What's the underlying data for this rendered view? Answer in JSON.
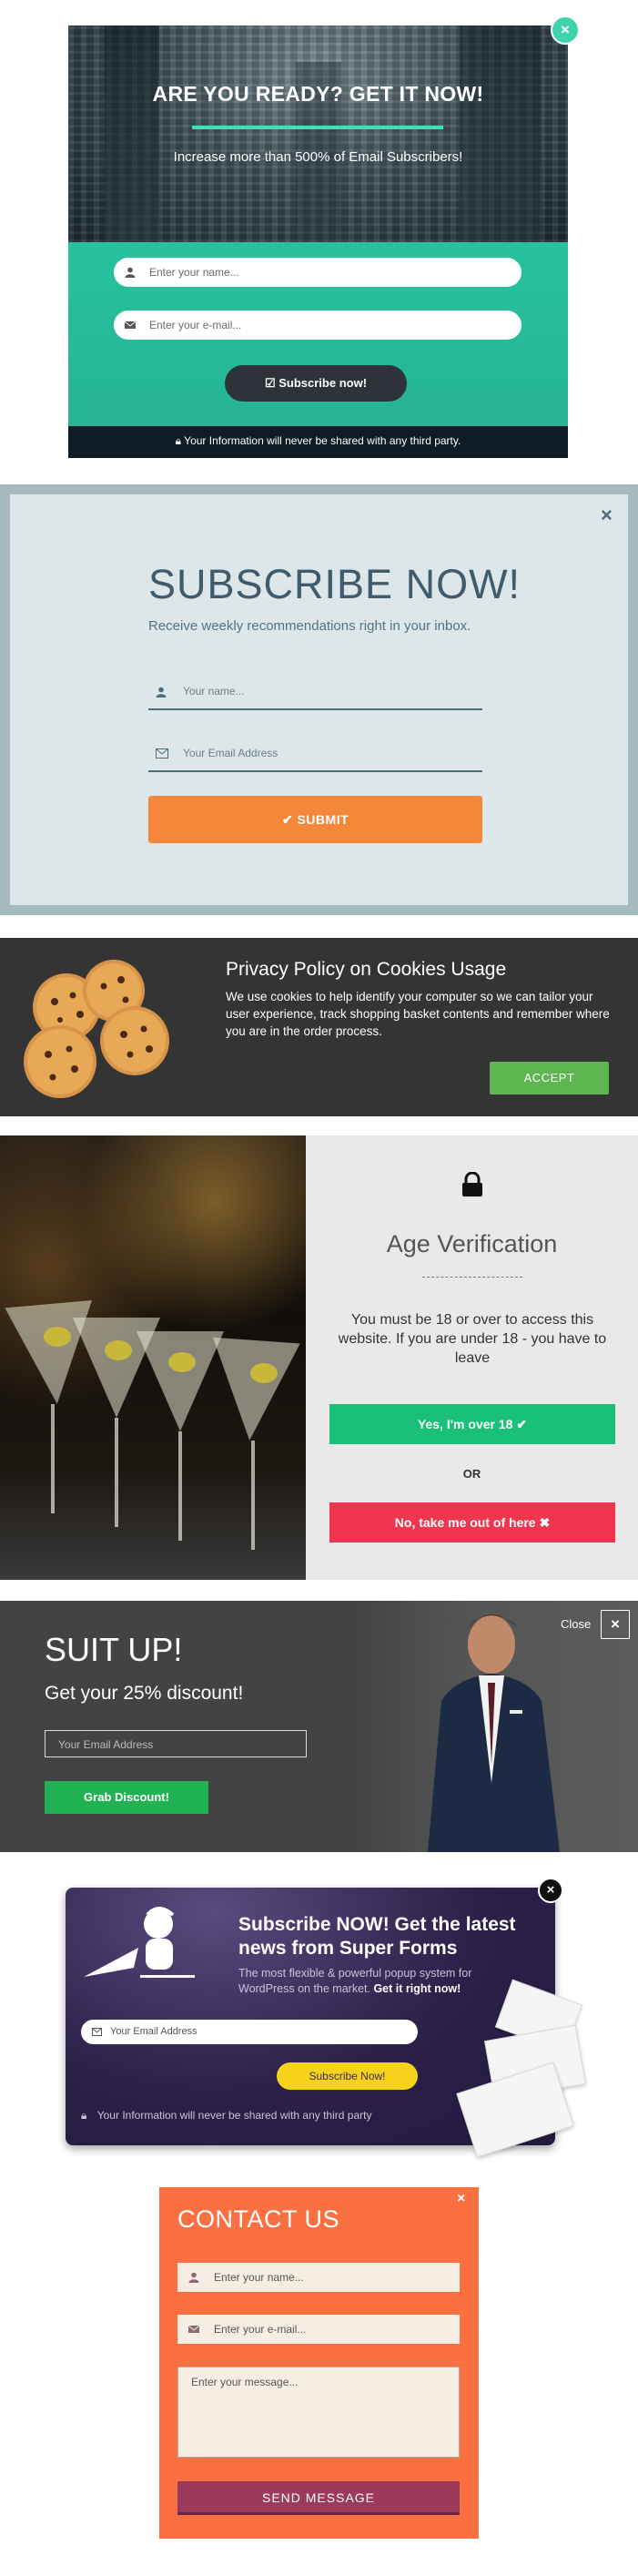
{
  "panel1": {
    "title": "ARE YOU READY? GET IT NOW!",
    "subtitle": "Increase more than 500% of Email Subscribers!",
    "name_placeholder": "Enter your name...",
    "email_placeholder": "Enter your e-mail...",
    "button": "Subscribe now!",
    "note": "Your Information will never be shared with any third party.",
    "colors": {
      "accent": "#2ec9a0",
      "button": "#2d3338"
    }
  },
  "panel2": {
    "title": "SUBSCRIBE NOW!",
    "subtitle": "Receive weekly recommendations right in your inbox.",
    "name_placeholder": "Your name...",
    "email_placeholder": "Your Email Address",
    "button": "SUBMIT",
    "colors": {
      "button": "#f5873a",
      "text": "#3f5b6c"
    }
  },
  "panel3": {
    "title": "Privacy Policy on Cookies Usage",
    "body": "We use cookies to help identify your computer so we can tailor your user experience, track shopping basket contents and remember where you are in the order process.",
    "button": "ACCEPT",
    "colors": {
      "button": "#5db650"
    }
  },
  "panel4": {
    "title": "Age Verification",
    "text": "You must be 18 or over to access this website. If you are under 18 - you have to leave",
    "yes_button": "Yes, I'm over 18",
    "or": "OR",
    "no_button": "No, take me out of here",
    "colors": {
      "yes": "#19c07a",
      "no": "#f0364f"
    }
  },
  "panel5": {
    "title": "SUIT UP!",
    "subtitle": "Get your 25% discount!",
    "email_placeholder": "Your Email Address",
    "button": "Grab Discount!",
    "close_label": "Close",
    "colors": {
      "button": "#21b353"
    }
  },
  "panel6": {
    "title": "Subscribe NOW! Get the latest news from Super Forms",
    "subtitle": "The most flexible & powerful popup system for WordPress on the market.",
    "subtitle_bold": "Get it right now!",
    "email_placeholder": "Your Email Address",
    "button": "Subscribe Now!",
    "note": "Your Information will never be shared with any third party",
    "colors": {
      "button": "#f7d21a"
    }
  },
  "panel7": {
    "title": "CONTACT US",
    "name_placeholder": "Enter your name...",
    "email_placeholder": "Enter your e-mail...",
    "message_placeholder": "Enter your message...",
    "button": "SEND MESSAGE",
    "colors": {
      "background": "#fb7040",
      "button": "#9b3a5a"
    }
  }
}
